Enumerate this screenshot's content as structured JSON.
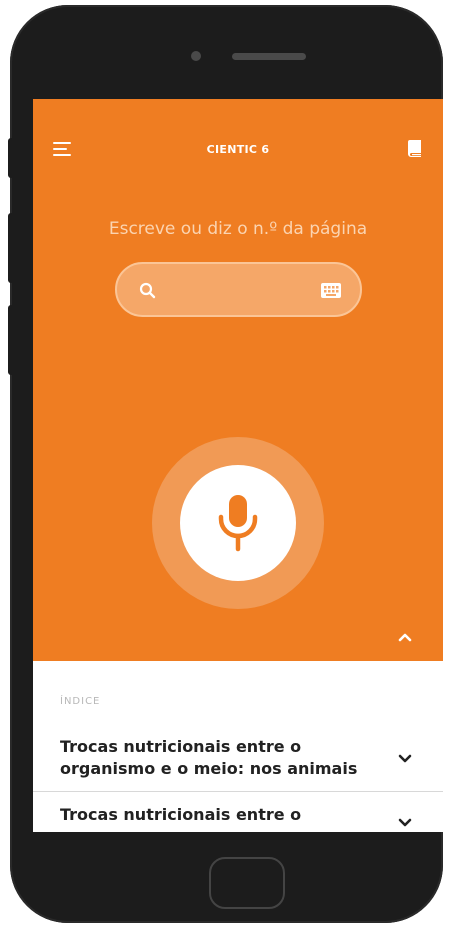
{
  "header": {
    "title": "CIENTIC 6"
  },
  "search": {
    "prompt": "Escreve ou diz o n.º da página",
    "placeholder": ""
  },
  "index": {
    "label": "ÍNDICE",
    "items": [
      {
        "title": "Trocas nutricionais entre o organismo e o meio: nos animais"
      },
      {
        "title": "Trocas nutricionais entre o"
      }
    ]
  },
  "colors": {
    "accent": "#ef7d22",
    "mic_ring": "#f19a55",
    "phone_body": "#1c1c1c"
  },
  "icons": {
    "menu": "hamburger-menu-icon",
    "book": "book-icon",
    "search": "search-icon",
    "keyboard": "keyboard-icon",
    "mic": "microphone-icon",
    "collapse": "chevron-up-icon",
    "expand": "chevron-down-icon"
  }
}
